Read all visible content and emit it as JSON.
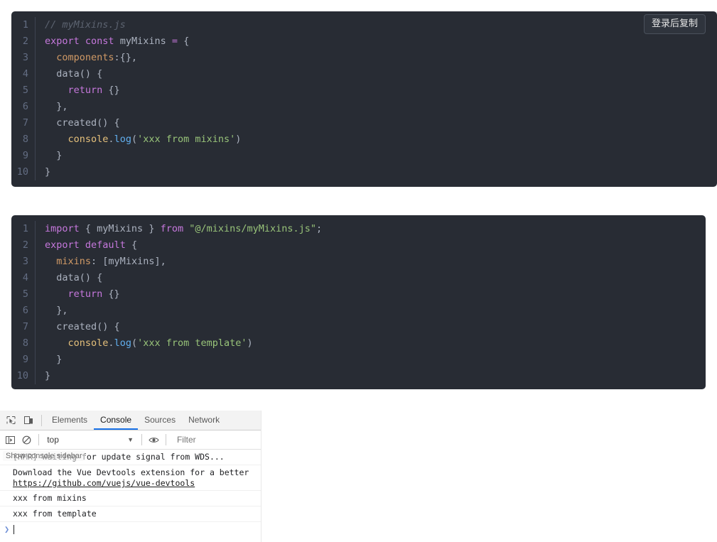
{
  "copy_button": {
    "label": "登录后复制",
    "name": "copy-after-login-button"
  },
  "code_blocks": [
    {
      "id": "mixin-definition",
      "lines": [
        {
          "no": "1",
          "tokens": [
            {
              "t": "// myMixins.js",
              "c": "t-com"
            }
          ]
        },
        {
          "no": "2",
          "tokens": [
            {
              "t": "export",
              "c": "t-key"
            },
            {
              "t": " ",
              "c": "t-pun"
            },
            {
              "t": "const",
              "c": "t-key"
            },
            {
              "t": " myMixins ",
              "c": "t-pun"
            },
            {
              "t": "=",
              "c": "t-key"
            },
            {
              "t": " {",
              "c": "t-pun"
            }
          ]
        },
        {
          "no": "3",
          "tokens": [
            {
              "t": "  ",
              "c": "t-pun"
            },
            {
              "t": "components",
              "c": "t-prop"
            },
            {
              "t": ":{},",
              "c": "t-pun"
            }
          ]
        },
        {
          "no": "4",
          "tokens": [
            {
              "t": "  ",
              "c": "t-pun"
            },
            {
              "t": "data",
              "c": "t-pun"
            },
            {
              "t": "() {",
              "c": "t-pun"
            }
          ]
        },
        {
          "no": "5",
          "tokens": [
            {
              "t": "    ",
              "c": "t-pun"
            },
            {
              "t": "return",
              "c": "t-key"
            },
            {
              "t": " {}",
              "c": "t-pun"
            }
          ]
        },
        {
          "no": "6",
          "tokens": [
            {
              "t": "  },",
              "c": "t-pun"
            }
          ]
        },
        {
          "no": "7",
          "tokens": [
            {
              "t": "  created() {",
              "c": "t-pun"
            }
          ]
        },
        {
          "no": "8",
          "tokens": [
            {
              "t": "    ",
              "c": "t-pun"
            },
            {
              "t": "console",
              "c": "t-obj"
            },
            {
              "t": ".",
              "c": "t-pun"
            },
            {
              "t": "log",
              "c": "t-fn"
            },
            {
              "t": "(",
              "c": "t-pun"
            },
            {
              "t": "'xxx from mixins'",
              "c": "t-str"
            },
            {
              "t": ")",
              "c": "t-pun"
            }
          ]
        },
        {
          "no": "9",
          "tokens": [
            {
              "t": "  }",
              "c": "t-pun"
            }
          ]
        },
        {
          "no": "10",
          "tokens": [
            {
              "t": "}",
              "c": "t-pun"
            }
          ]
        }
      ]
    },
    {
      "id": "component-usage",
      "lines": [
        {
          "no": "1",
          "tokens": [
            {
              "t": "import",
              "c": "t-key"
            },
            {
              "t": " { myMixins } ",
              "c": "t-pun"
            },
            {
              "t": "from",
              "c": "t-key"
            },
            {
              "t": " ",
              "c": "t-pun"
            },
            {
              "t": "\"@/mixins/myMixins.js\"",
              "c": "t-str"
            },
            {
              "t": ";",
              "c": "t-pun"
            }
          ]
        },
        {
          "no": "2",
          "tokens": [
            {
              "t": "export",
              "c": "t-key"
            },
            {
              "t": " ",
              "c": "t-pun"
            },
            {
              "t": "default",
              "c": "t-key"
            },
            {
              "t": " {",
              "c": "t-pun"
            }
          ]
        },
        {
          "no": "3",
          "tokens": [
            {
              "t": "  ",
              "c": "t-pun"
            },
            {
              "t": "mixins",
              "c": "t-prop"
            },
            {
              "t": ": [myMixins],",
              "c": "t-pun"
            }
          ]
        },
        {
          "no": "4",
          "tokens": [
            {
              "t": "  data() {",
              "c": "t-pun"
            }
          ]
        },
        {
          "no": "5",
          "tokens": [
            {
              "t": "    ",
              "c": "t-pun"
            },
            {
              "t": "return",
              "c": "t-key"
            },
            {
              "t": " {}",
              "c": "t-pun"
            }
          ]
        },
        {
          "no": "6",
          "tokens": [
            {
              "t": "  },",
              "c": "t-pun"
            }
          ]
        },
        {
          "no": "7",
          "tokens": [
            {
              "t": "  created() {",
              "c": "t-pun"
            }
          ]
        },
        {
          "no": "8",
          "tokens": [
            {
              "t": "    ",
              "c": "t-pun"
            },
            {
              "t": "console",
              "c": "t-obj"
            },
            {
              "t": ".",
              "c": "t-pun"
            },
            {
              "t": "log",
              "c": "t-fn"
            },
            {
              "t": "(",
              "c": "t-pun"
            },
            {
              "t": "'xxx from template'",
              "c": "t-str"
            },
            {
              "t": ")",
              "c": "t-pun"
            }
          ]
        },
        {
          "no": "9",
          "tokens": [
            {
              "t": "  }",
              "c": "t-pun"
            }
          ]
        },
        {
          "no": "10",
          "tokens": [
            {
              "t": "}",
              "c": "t-pun"
            }
          ]
        }
      ]
    }
  ],
  "devtools": {
    "tabs": [
      {
        "label": "Elements",
        "active": false
      },
      {
        "label": "Console",
        "active": true
      },
      {
        "label": "Sources",
        "active": false
      },
      {
        "label": "Network",
        "active": false
      }
    ],
    "toolbar": {
      "context": "top",
      "filter_placeholder": "Filter"
    },
    "tooltip": "Show console sidebar",
    "messages": [
      {
        "text": "[HMR] Waiting for update signal from WDS..."
      },
      {
        "text": "Download the Vue Devtools extension for a better ",
        "link": "https://github.com/vuejs/vue-devtools"
      },
      {
        "text": "xxx from mixins"
      },
      {
        "text": "xxx from template"
      }
    ]
  },
  "colors": {
    "code_bg": "#282c34",
    "gutter_text": "#636d83",
    "keyword": "#c678dd",
    "string": "#98c379",
    "function": "#61afef",
    "property": "#d19a66",
    "object": "#e5c07b",
    "comment": "#5c6370",
    "default_text": "#abb2bf",
    "devtools_accent": "#1a73e8"
  }
}
